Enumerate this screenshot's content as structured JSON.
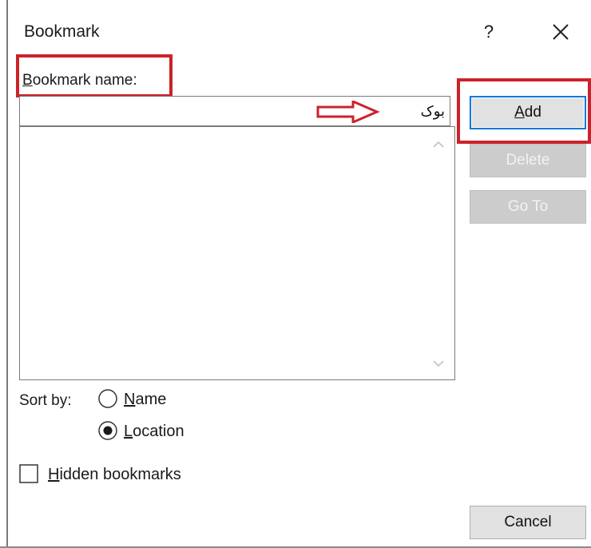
{
  "dialog": {
    "title": "Bookmark",
    "help_label": "?",
    "close_icon": "close-icon"
  },
  "bookmark_name": {
    "label_first": "B",
    "label_rest": "ookmark name:",
    "value": "بوک"
  },
  "annotations": {
    "highlight_color": "#cc2229",
    "arrow_icon": "right-arrow-outline-icon"
  },
  "bookmark_list": {
    "items": []
  },
  "buttons": {
    "add_first": "A",
    "add_rest": "dd",
    "delete": "Delete",
    "goto": "Go To",
    "cancel": "Cancel"
  },
  "sort": {
    "label": "Sort by:",
    "name_first": "N",
    "name_rest": "ame",
    "location_first": "L",
    "location_rest": "ocation",
    "selected": "location"
  },
  "hidden_bookmarks": {
    "label_first": "H",
    "label_rest": "idden bookmarks",
    "checked": false
  },
  "colors": {
    "accent": "#0078d7",
    "highlight": "#cc2229",
    "disabled_button": "#cccccc"
  }
}
